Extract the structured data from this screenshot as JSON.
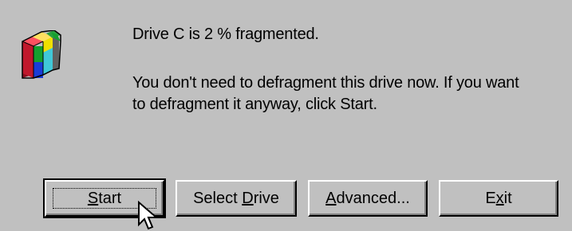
{
  "dialog": {
    "message_line1": "Drive C is 2 % fragmented.",
    "message_line2a": "You don't need to defragment this drive now. If you want",
    "message_line2b": "to defragment it anyway, click Start."
  },
  "buttons": {
    "start": {
      "pre": "",
      "key": "S",
      "post": "tart"
    },
    "select_drive": {
      "pre": "Select ",
      "key": "D",
      "post": "rive"
    },
    "advanced": {
      "pre": "",
      "key": "A",
      "post": "dvanced..."
    },
    "exit": {
      "pre": "E",
      "key": "x",
      "post": "it"
    }
  },
  "icons": {
    "app": "disk-defragmenter-icon",
    "cursor": "mouse-pointer-icon"
  },
  "colors": {
    "face": "#c0c0c0",
    "highlight": "#ffffff",
    "shadow": "#808080",
    "dark": "#000000",
    "icon_red": "#e8203a",
    "icon_green": "#14a02e",
    "icon_blue": "#1a3cd8",
    "icon_yellow": "#f0e000",
    "icon_cyan": "#40c8d8"
  }
}
